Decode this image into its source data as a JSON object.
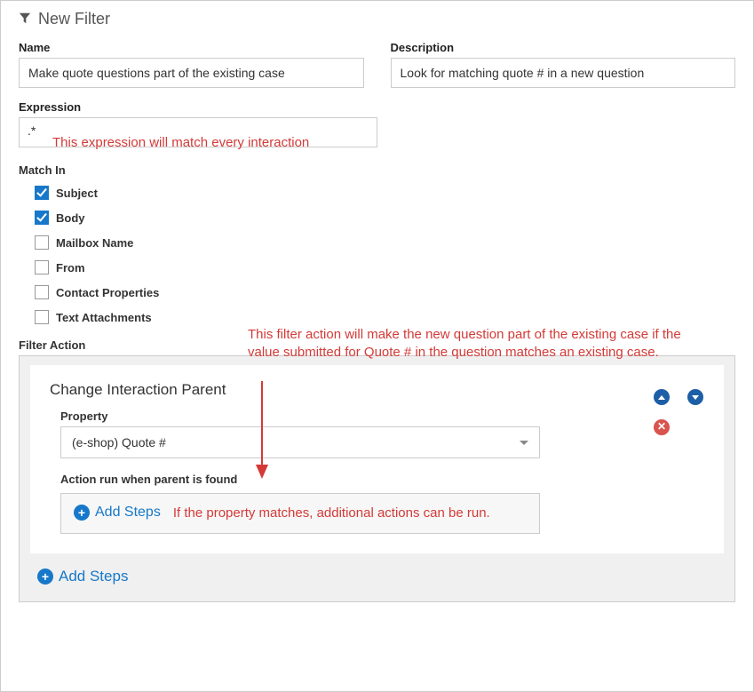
{
  "header": {
    "title": "New Filter"
  },
  "fields": {
    "name_label": "Name",
    "name_value": "Make quote questions part of the existing case",
    "desc_label": "Description",
    "desc_value": "Look for matching quote # in a new question",
    "expr_label": "Expression",
    "expr_value": ".*"
  },
  "match": {
    "label": "Match In",
    "items": [
      {
        "label": "Subject",
        "checked": true
      },
      {
        "label": "Body",
        "checked": true
      },
      {
        "label": "Mailbox Name",
        "checked": false
      },
      {
        "label": "From",
        "checked": false
      },
      {
        "label": "Contact Properties",
        "checked": false
      },
      {
        "label": "Text Attachments",
        "checked": false
      }
    ]
  },
  "action": {
    "label": "Filter Action",
    "card_title": "Change Interaction Parent",
    "property_label": "Property",
    "property_value": "(e-shop) Quote #",
    "sub_label": "Action run when parent is found",
    "add_steps_label": "Add Steps"
  },
  "annotations": {
    "expr_note": "This expression will match every interaction",
    "action_note": "This filter action will make the new question part of the existing case if the value submitted for Quote # in the question matches an existing case.",
    "substeps_note": "If the property matches, additional actions can be run."
  }
}
